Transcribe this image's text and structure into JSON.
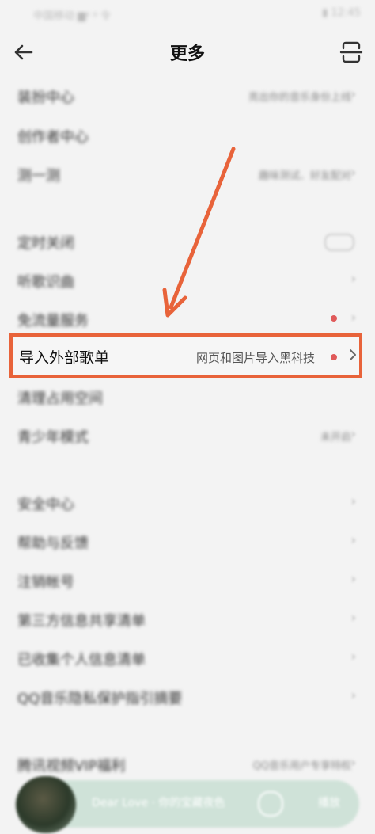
{
  "status_bar": {
    "left": "中国移动 ▆ᵍ ᵍ 令",
    "right": "▮ 12:45"
  },
  "header": {
    "title": "更多",
    "back_icon": "back-arrow-icon",
    "scan_icon": "scan-icon"
  },
  "menu": {
    "items": [
      {
        "label": "装扮中心",
        "value": "亮出你的音乐身份上线"
      },
      {
        "label": "创作者中心",
        "value": ""
      },
      {
        "label": "测一测",
        "value": "趣味测试、好友配对"
      },
      {
        "label": "定时关闭",
        "value": ""
      },
      {
        "label": "听歌识曲",
        "value": ""
      },
      {
        "label": "免流量服务",
        "value": ""
      },
      {
        "label": "导入外部歌单",
        "value": "网页和图片导入黑科技"
      },
      {
        "label": "清理占用空间",
        "value": ""
      },
      {
        "label": "青少年模式",
        "value": "未开启"
      },
      {
        "label": "安全中心",
        "value": ""
      },
      {
        "label": "帮助与反馈",
        "value": ""
      },
      {
        "label": "注销帐号",
        "value": ""
      },
      {
        "label": "第三方信息共享清单",
        "value": ""
      },
      {
        "label": "已收集个人信息清单",
        "value": ""
      },
      {
        "label": "QQ音乐隐私保护指引摘要",
        "value": ""
      },
      {
        "label": "腾讯视频VIP福利",
        "value": "QQ音乐用户专享特权"
      }
    ]
  },
  "player": {
    "text": "Dear Love · 你的宝藏夜色",
    "control": "播放"
  },
  "colors": {
    "highlight": "#e8633a",
    "badge": "#e05a5a",
    "background": "#f3f3f3"
  }
}
